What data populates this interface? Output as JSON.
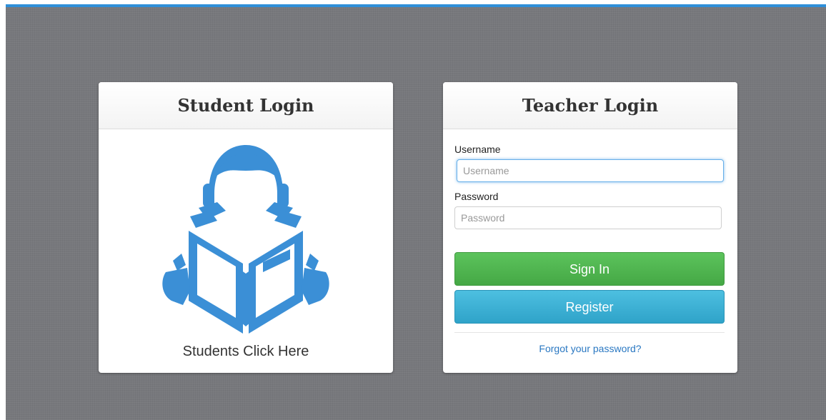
{
  "student": {
    "title": "Student Login",
    "caption": "Students Click Here",
    "illustration_icon": "student-reading-book-icon",
    "icon_color": "#3b8fd6"
  },
  "teacher": {
    "title": "Teacher Login",
    "username_label": "Username",
    "username_placeholder": "Username",
    "password_label": "Password",
    "password_placeholder": "Password",
    "signin_label": "Sign In",
    "register_label": "Register",
    "forgot_label": "Forgot your password?"
  },
  "colors": {
    "accent": "#2f8fd8",
    "signin": "#4cb24c",
    "register": "#35a9d0",
    "link": "#2a78c2"
  }
}
